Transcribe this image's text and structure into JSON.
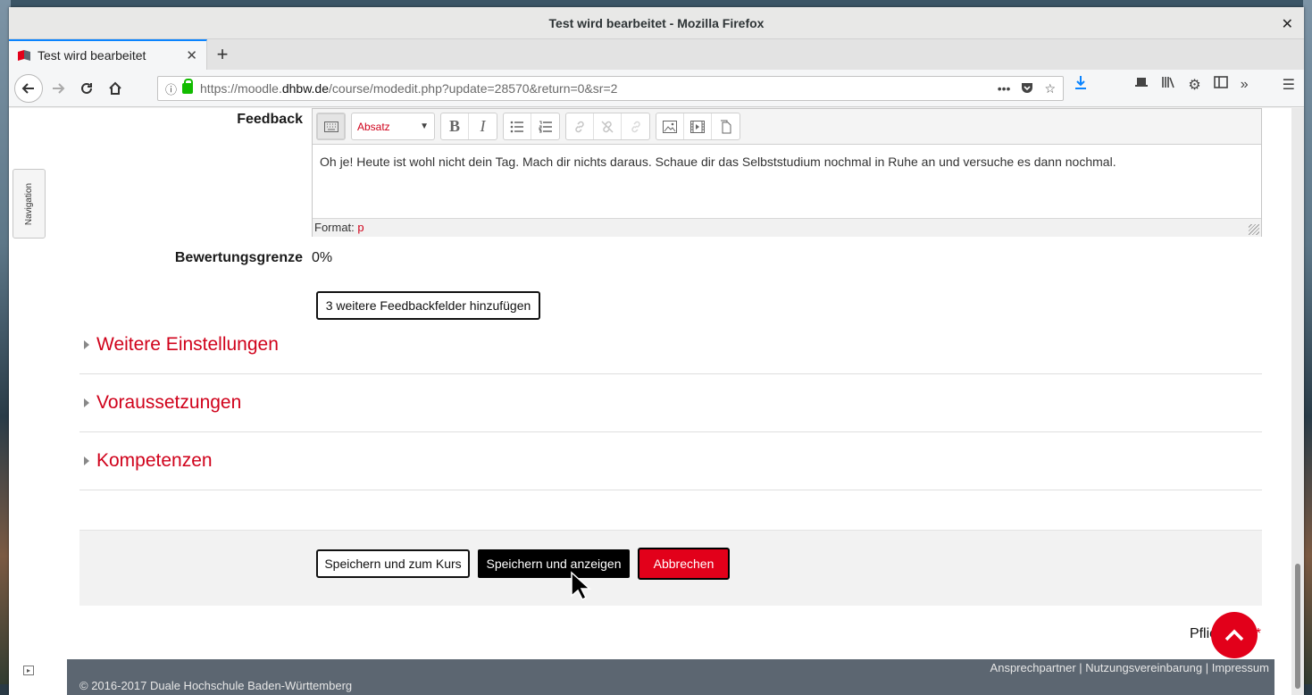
{
  "window": {
    "title": "Test wird bearbeitet - Mozilla Firefox",
    "close_glyph": "✕"
  },
  "tab": {
    "title": "Test wird bearbeitet",
    "close_glyph": "✕",
    "new_tab_glyph": "+"
  },
  "url": {
    "prefix": "https://moodle.",
    "domain": "dhbw.de",
    "path": "/course/modedit.php?update=28570&return=0&sr=2"
  },
  "sidebar": {
    "navigation_label": "Navigation"
  },
  "feedback": {
    "label": "Feedback",
    "format_select": "Absatz",
    "text": "Oh je! Heute ist wohl nicht dein Tag. Mach dir nichts daraus. Schaue dir das Selbststudium nochmal in Ruhe an und versuche es dann nochmal.",
    "format_label": "Format:",
    "format_value": "p"
  },
  "grade_boundary": {
    "label": "Bewertungsgrenze",
    "value": "0%"
  },
  "add_feedback_button": "3 weitere Feedbackfelder hinzufügen",
  "sections": [
    {
      "title": "Weitere Einstellungen"
    },
    {
      "title": "Voraussetzungen"
    },
    {
      "title": "Kompetenzen"
    }
  ],
  "actions": {
    "save_return": "Speichern und zum Kurs",
    "save_display": "Speichern und anzeigen",
    "cancel": "Abbrechen"
  },
  "required_text": "Pflichtfeld",
  "required_star": "*",
  "footer": {
    "links": [
      "Ansprechpartner",
      "Nutzungsvereinbarung",
      "Impressum"
    ],
    "copyright": "© 2016-2017 Duale Hochschule Baden-Württemberg"
  },
  "colors": {
    "accent": "#e2001a",
    "footer_bg": "#5c6671",
    "firefox_blue": "#0a84ff"
  }
}
